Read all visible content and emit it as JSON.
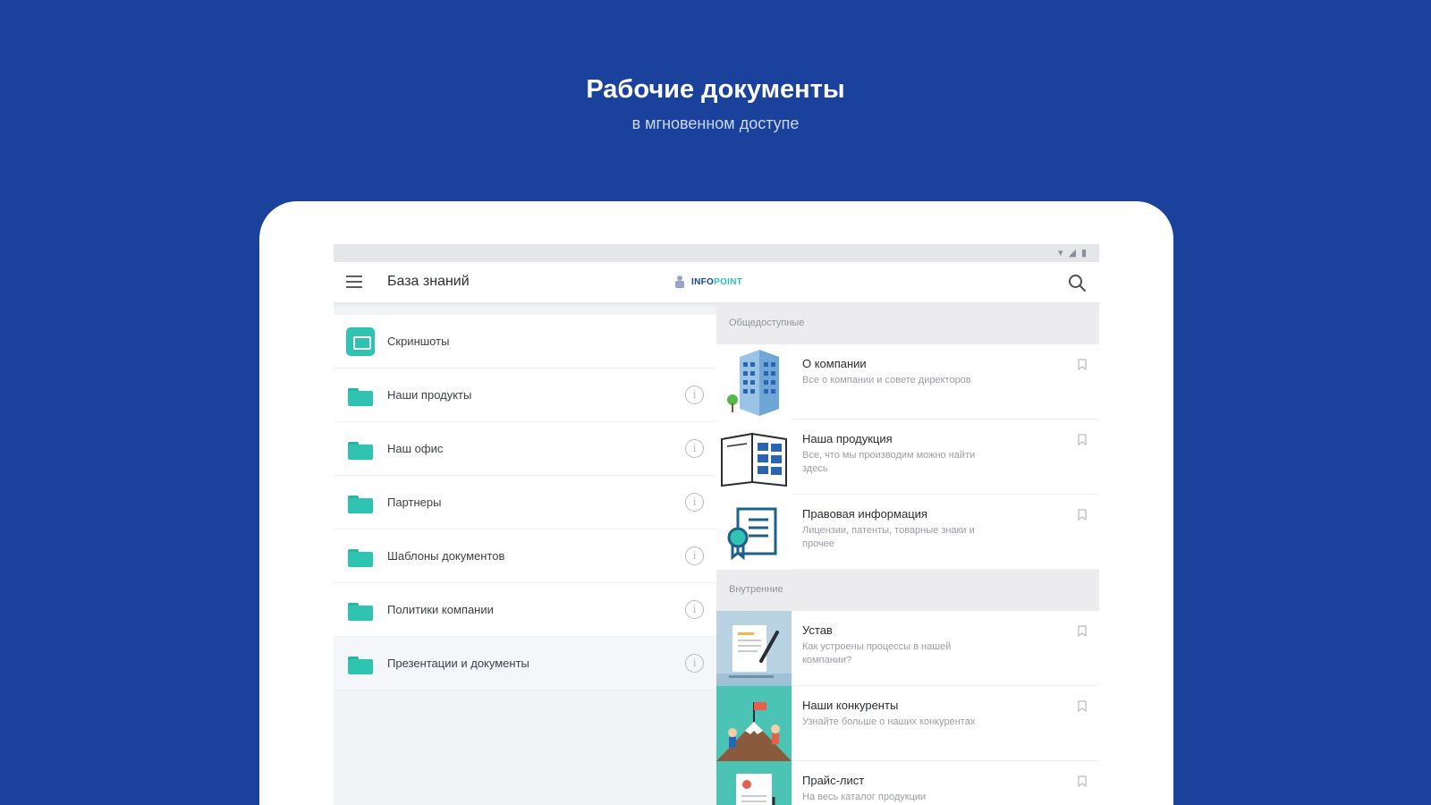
{
  "promo": {
    "title": "Рабочие документы",
    "subtitle": "в мгновенном доступе"
  },
  "colors": {
    "background": "#1a419b",
    "accent": "#2fc4b1",
    "logo_primary": "#1a419b",
    "logo_secondary": "#29c5b6"
  },
  "status_icons": [
    "wifi-icon",
    "signal-icon",
    "battery-icon"
  ],
  "appbar": {
    "title": "База знаний",
    "logo_text_a": "INFO",
    "logo_text_b": "POINT"
  },
  "folders": [
    {
      "label": "Скриншоты",
      "icon": "screenshots-icon",
      "has_info": false
    },
    {
      "label": "Наши продукты",
      "icon": "folder-icon",
      "has_info": true
    },
    {
      "label": "Наш офис",
      "icon": "folder-icon",
      "has_info": true
    },
    {
      "label": "Партнеры",
      "icon": "folder-icon",
      "has_info": true
    },
    {
      "label": "Шаблоны документов",
      "icon": "folder-icon",
      "has_info": true
    },
    {
      "label": "Политики компании",
      "icon": "folder-icon",
      "has_info": true
    },
    {
      "label": "Презентации и документы",
      "icon": "folder-icon",
      "has_info": true
    }
  ],
  "sections": {
    "public": {
      "header": "Общедоступные",
      "items": [
        {
          "title": "О компании",
          "desc": "Все о компании и совете директоров",
          "thumb": "office-building-icon"
        },
        {
          "title": "Наша продукция",
          "desc": "Все, что мы производим можно найти здесь",
          "thumb": "catalog-book-icon"
        },
        {
          "title": "Правовая информация",
          "desc": "Лицензии, патенты, товарные знаки и прочее",
          "thumb": "certificate-icon"
        }
      ]
    },
    "internal": {
      "header": "Внутренние",
      "items": [
        {
          "title": "Устав",
          "desc": "Как устроены процессы в нашей компании?",
          "thumb": "charter-document-icon"
        },
        {
          "title": "Наши конкуренты",
          "desc": "Узнайте больше о наших конкурентах",
          "thumb": "mountain-competitors-icon"
        },
        {
          "title": "Прайс-лист",
          "desc": "На весь каталог продукции",
          "thumb": "price-list-icon"
        }
      ]
    }
  }
}
